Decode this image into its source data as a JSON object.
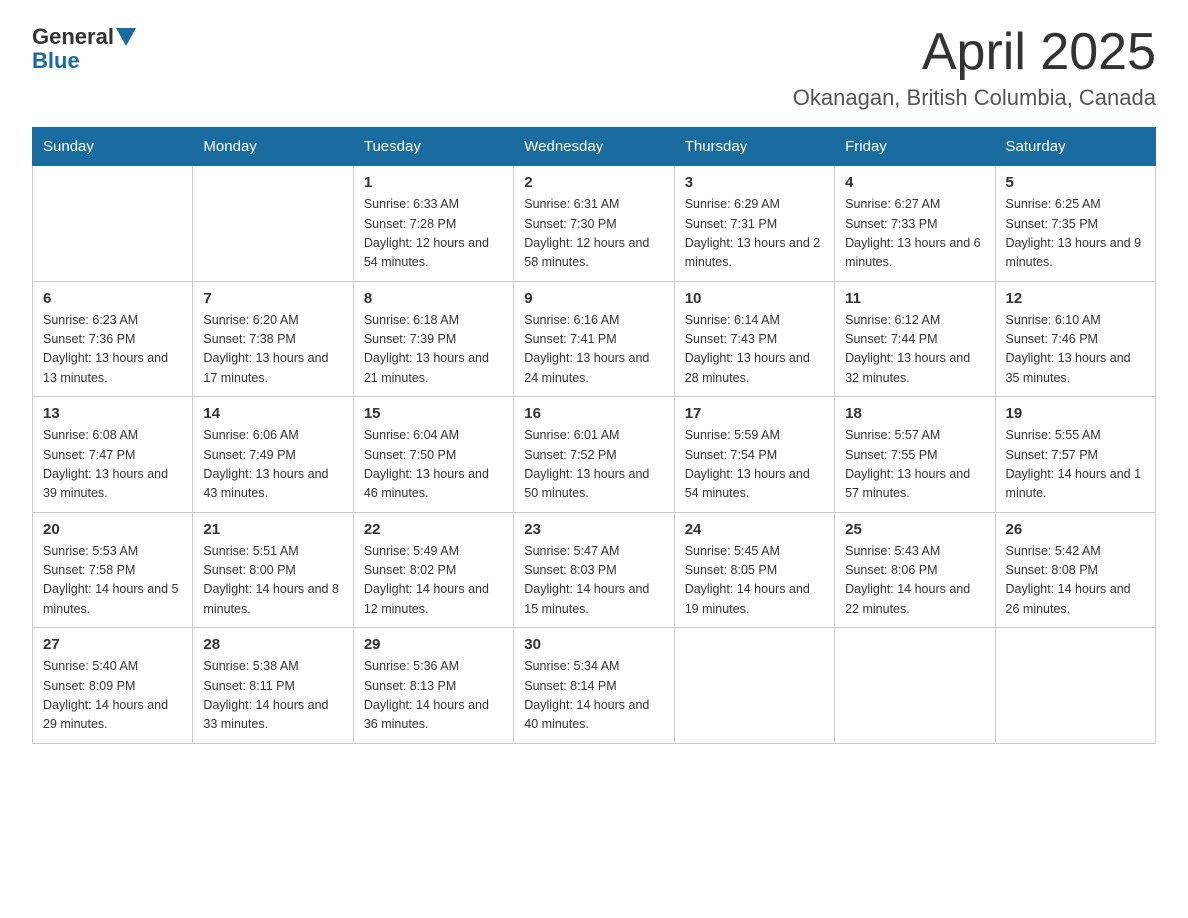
{
  "header": {
    "logo_general": "General",
    "logo_blue": "Blue",
    "month_title": "April 2025",
    "location": "Okanagan, British Columbia, Canada"
  },
  "days_of_week": [
    "Sunday",
    "Monday",
    "Tuesday",
    "Wednesday",
    "Thursday",
    "Friday",
    "Saturday"
  ],
  "weeks": [
    [
      {
        "day": "",
        "sunrise": "",
        "sunset": "",
        "daylight": ""
      },
      {
        "day": "",
        "sunrise": "",
        "sunset": "",
        "daylight": ""
      },
      {
        "day": "1",
        "sunrise": "Sunrise: 6:33 AM",
        "sunset": "Sunset: 7:28 PM",
        "daylight": "Daylight: 12 hours and 54 minutes."
      },
      {
        "day": "2",
        "sunrise": "Sunrise: 6:31 AM",
        "sunset": "Sunset: 7:30 PM",
        "daylight": "Daylight: 12 hours and 58 minutes."
      },
      {
        "day": "3",
        "sunrise": "Sunrise: 6:29 AM",
        "sunset": "Sunset: 7:31 PM",
        "daylight": "Daylight: 13 hours and 2 minutes."
      },
      {
        "day": "4",
        "sunrise": "Sunrise: 6:27 AM",
        "sunset": "Sunset: 7:33 PM",
        "daylight": "Daylight: 13 hours and 6 minutes."
      },
      {
        "day": "5",
        "sunrise": "Sunrise: 6:25 AM",
        "sunset": "Sunset: 7:35 PM",
        "daylight": "Daylight: 13 hours and 9 minutes."
      }
    ],
    [
      {
        "day": "6",
        "sunrise": "Sunrise: 6:23 AM",
        "sunset": "Sunset: 7:36 PM",
        "daylight": "Daylight: 13 hours and 13 minutes."
      },
      {
        "day": "7",
        "sunrise": "Sunrise: 6:20 AM",
        "sunset": "Sunset: 7:38 PM",
        "daylight": "Daylight: 13 hours and 17 minutes."
      },
      {
        "day": "8",
        "sunrise": "Sunrise: 6:18 AM",
        "sunset": "Sunset: 7:39 PM",
        "daylight": "Daylight: 13 hours and 21 minutes."
      },
      {
        "day": "9",
        "sunrise": "Sunrise: 6:16 AM",
        "sunset": "Sunset: 7:41 PM",
        "daylight": "Daylight: 13 hours and 24 minutes."
      },
      {
        "day": "10",
        "sunrise": "Sunrise: 6:14 AM",
        "sunset": "Sunset: 7:43 PM",
        "daylight": "Daylight: 13 hours and 28 minutes."
      },
      {
        "day": "11",
        "sunrise": "Sunrise: 6:12 AM",
        "sunset": "Sunset: 7:44 PM",
        "daylight": "Daylight: 13 hours and 32 minutes."
      },
      {
        "day": "12",
        "sunrise": "Sunrise: 6:10 AM",
        "sunset": "Sunset: 7:46 PM",
        "daylight": "Daylight: 13 hours and 35 minutes."
      }
    ],
    [
      {
        "day": "13",
        "sunrise": "Sunrise: 6:08 AM",
        "sunset": "Sunset: 7:47 PM",
        "daylight": "Daylight: 13 hours and 39 minutes."
      },
      {
        "day": "14",
        "sunrise": "Sunrise: 6:06 AM",
        "sunset": "Sunset: 7:49 PM",
        "daylight": "Daylight: 13 hours and 43 minutes."
      },
      {
        "day": "15",
        "sunrise": "Sunrise: 6:04 AM",
        "sunset": "Sunset: 7:50 PM",
        "daylight": "Daylight: 13 hours and 46 minutes."
      },
      {
        "day": "16",
        "sunrise": "Sunrise: 6:01 AM",
        "sunset": "Sunset: 7:52 PM",
        "daylight": "Daylight: 13 hours and 50 minutes."
      },
      {
        "day": "17",
        "sunrise": "Sunrise: 5:59 AM",
        "sunset": "Sunset: 7:54 PM",
        "daylight": "Daylight: 13 hours and 54 minutes."
      },
      {
        "day": "18",
        "sunrise": "Sunrise: 5:57 AM",
        "sunset": "Sunset: 7:55 PM",
        "daylight": "Daylight: 13 hours and 57 minutes."
      },
      {
        "day": "19",
        "sunrise": "Sunrise: 5:55 AM",
        "sunset": "Sunset: 7:57 PM",
        "daylight": "Daylight: 14 hours and 1 minute."
      }
    ],
    [
      {
        "day": "20",
        "sunrise": "Sunrise: 5:53 AM",
        "sunset": "Sunset: 7:58 PM",
        "daylight": "Daylight: 14 hours and 5 minutes."
      },
      {
        "day": "21",
        "sunrise": "Sunrise: 5:51 AM",
        "sunset": "Sunset: 8:00 PM",
        "daylight": "Daylight: 14 hours and 8 minutes."
      },
      {
        "day": "22",
        "sunrise": "Sunrise: 5:49 AM",
        "sunset": "Sunset: 8:02 PM",
        "daylight": "Daylight: 14 hours and 12 minutes."
      },
      {
        "day": "23",
        "sunrise": "Sunrise: 5:47 AM",
        "sunset": "Sunset: 8:03 PM",
        "daylight": "Daylight: 14 hours and 15 minutes."
      },
      {
        "day": "24",
        "sunrise": "Sunrise: 5:45 AM",
        "sunset": "Sunset: 8:05 PM",
        "daylight": "Daylight: 14 hours and 19 minutes."
      },
      {
        "day": "25",
        "sunrise": "Sunrise: 5:43 AM",
        "sunset": "Sunset: 8:06 PM",
        "daylight": "Daylight: 14 hours and 22 minutes."
      },
      {
        "day": "26",
        "sunrise": "Sunrise: 5:42 AM",
        "sunset": "Sunset: 8:08 PM",
        "daylight": "Daylight: 14 hours and 26 minutes."
      }
    ],
    [
      {
        "day": "27",
        "sunrise": "Sunrise: 5:40 AM",
        "sunset": "Sunset: 8:09 PM",
        "daylight": "Daylight: 14 hours and 29 minutes."
      },
      {
        "day": "28",
        "sunrise": "Sunrise: 5:38 AM",
        "sunset": "Sunset: 8:11 PM",
        "daylight": "Daylight: 14 hours and 33 minutes."
      },
      {
        "day": "29",
        "sunrise": "Sunrise: 5:36 AM",
        "sunset": "Sunset: 8:13 PM",
        "daylight": "Daylight: 14 hours and 36 minutes."
      },
      {
        "day": "30",
        "sunrise": "Sunrise: 5:34 AM",
        "sunset": "Sunset: 8:14 PM",
        "daylight": "Daylight: 14 hours and 40 minutes."
      },
      {
        "day": "",
        "sunrise": "",
        "sunset": "",
        "daylight": ""
      },
      {
        "day": "",
        "sunrise": "",
        "sunset": "",
        "daylight": ""
      },
      {
        "day": "",
        "sunrise": "",
        "sunset": "",
        "daylight": ""
      }
    ]
  ]
}
